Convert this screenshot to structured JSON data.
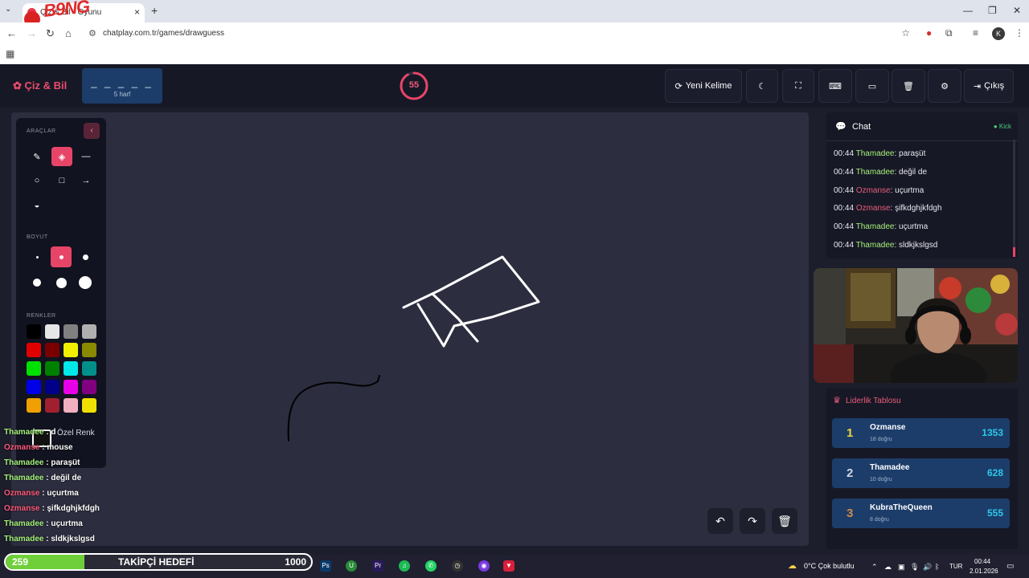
{
  "browser": {
    "tab_title": "Çiz & Bil - Oyunu",
    "tab_close": "×",
    "new_tab": "+",
    "url": "chatplay.com.tr/games/drawguess",
    "profile_initial": "K",
    "window_controls": [
      "—",
      "❐",
      "✕"
    ],
    "logo_letters": "B9NG"
  },
  "header": {
    "brand": "Çiz & Bil",
    "word_blanks": "_ _ _ _ _",
    "word_hint": "5 harf",
    "timer": "55",
    "timer_progress": 0.92,
    "new_word": "Yeni Kelime",
    "exit": "Çıkış"
  },
  "tools": {
    "section_tools": "ARAÇLAR",
    "section_size": "BOYUT",
    "section_colors": "RENKLER",
    "tool_icons": [
      "brush-icon",
      "eraser-icon",
      "line-icon",
      "circle-icon",
      "rectangle-icon",
      "arrow-icon",
      "fill-icon"
    ],
    "active_tool": "eraser",
    "active_size": 2,
    "colors": [
      "#000000",
      "#e6e6e6",
      "#808080",
      "#b0b0b0",
      "#e00000",
      "#7a0000",
      "#f0f000",
      "#8a8a00",
      "#00e000",
      "#008000",
      "#00e8e8",
      "#00908a",
      "#0000e8",
      "#00008a",
      "#e800e8",
      "#800080",
      "#f0a000",
      "#a02030",
      "#f0b0c0",
      "#f0e000"
    ],
    "custom_color_label": "Özel Renk"
  },
  "overlay_chat": [
    {
      "user": "Thamadee",
      "text": " : d",
      "color": "#a4f07a"
    },
    {
      "user": "Ozmanse",
      "text": " : mouse",
      "color": "#ff5a7a"
    },
    {
      "user": "Thamadee",
      "text": " : paraşüt",
      "color": "#a4f07a"
    },
    {
      "user": "Thamadee",
      "text": " : değil de",
      "color": "#a4f07a"
    },
    {
      "user": "Ozmanse",
      "text": " : uçurtma",
      "color": "#ff5a7a"
    },
    {
      "user": "Ozmanse",
      "text": " : şifkdghjkfdgh",
      "color": "#ff5a7a"
    },
    {
      "user": "Thamadee",
      "text": " : uçurtma",
      "color": "#a4f07a"
    },
    {
      "user": "Thamadee",
      "text": " : sldkjkslgsd",
      "color": "#a4f07a"
    }
  ],
  "chat": {
    "title": "Chat",
    "status": "Kick",
    "messages": [
      {
        "time": "00:44",
        "user": "Thamadee",
        "text": ": paraşüt",
        "color": "#a4f07a"
      },
      {
        "time": "00:44",
        "user": "Thamadee",
        "text": ": değil de",
        "color": "#a4f07a"
      },
      {
        "time": "00:44",
        "user": "Ozmanse",
        "text": ": uçurtma",
        "color": "#e95d7a"
      },
      {
        "time": "00:44",
        "user": "Ozmanse",
        "text": ": şifkdghjkfdgh",
        "color": "#e95d7a"
      },
      {
        "time": "00:44",
        "user": "Thamadee",
        "text": ": uçurtma",
        "color": "#a4f07a"
      },
      {
        "time": "00:44",
        "user": "Thamadee",
        "text": ": sldkjkslgsd",
        "color": "#a4f07a"
      }
    ]
  },
  "leaderboard": {
    "title": "Liderlik Tablosu",
    "rows": [
      {
        "rank": "1",
        "name": "Ozmanse",
        "sub": "18 doğru",
        "score": "1353",
        "rank_color": "#f2d23a"
      },
      {
        "rank": "2",
        "name": "Thamadee",
        "sub": "10 doğru",
        "score": "628",
        "rank_color": "#cfd6e2"
      },
      {
        "rank": "3",
        "name": "KubraTheQueen",
        "sub": "8 doğru",
        "score": "555",
        "rank_color": "#d08a4a"
      }
    ]
  },
  "stream": {
    "follow_current": "259",
    "follow_label": "TAKİPÇİ HEDEFİ",
    "follow_goal": "1000",
    "follow_progress": 0.259
  },
  "taskbar": {
    "weather": "0°C  Çok bulutlu",
    "lang": "TUR",
    "time": "00:44",
    "date": "2.01.2026"
  }
}
